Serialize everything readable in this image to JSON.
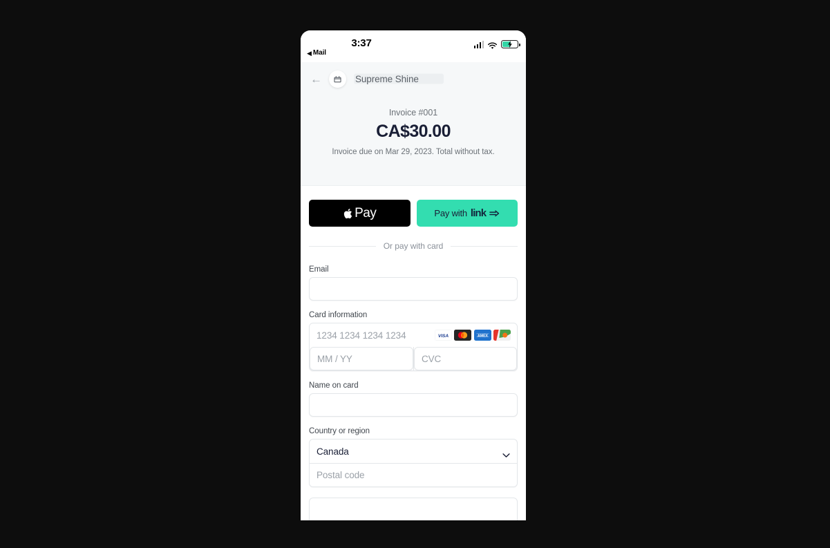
{
  "status_bar": {
    "back_arrow": "◀",
    "back_app": "Mail",
    "time": "3:37",
    "signal_icon": "cellular-bars-icon",
    "wifi_icon": "wifi-icon",
    "battery_icon": "battery-charging-icon"
  },
  "merchant_header": {
    "back_icon": "←",
    "logo_icon": "storefront-icon",
    "name": "Supreme Shine"
  },
  "invoice": {
    "label": "Invoice #001",
    "amount": "CA$30.00",
    "due_note": "Invoice due on Mar 29, 2023. Total without tax."
  },
  "wallets": {
    "apple_pay_logo": "apple-icon",
    "apple_pay_label": "Pay",
    "link_prefix": "Pay with",
    "link_word": "link",
    "link_arrow_icon": "link-arrow-icon"
  },
  "divider": {
    "text": "Or pay with card"
  },
  "form": {
    "email_label": "Email",
    "email_value": "",
    "email_placeholder": "",
    "card_info_label": "Card information",
    "card_number_placeholder": "1234 1234 1234 1234",
    "card_number_value": "",
    "expiry_placeholder": "MM / YY",
    "expiry_value": "",
    "cvc_placeholder": "CVC",
    "cvc_value": "",
    "card_brands": [
      "visa-icon",
      "mastercard-icon",
      "amex-icon",
      "discover-icon"
    ],
    "name_label": "Name on card",
    "name_value": "",
    "name_placeholder": "",
    "country_label": "Country or region",
    "country_value": "Canada",
    "country_chevron_icon": "chevron-down-icon",
    "postal_placeholder": "Postal code",
    "postal_value": ""
  },
  "colors": {
    "link_green": "#33ddb0",
    "apple_black": "#000000",
    "panel_gray": "#f6f8f9",
    "text_dark": "#1a1f36",
    "text_muted": "#6b7177",
    "border": "#e3e6e9"
  }
}
